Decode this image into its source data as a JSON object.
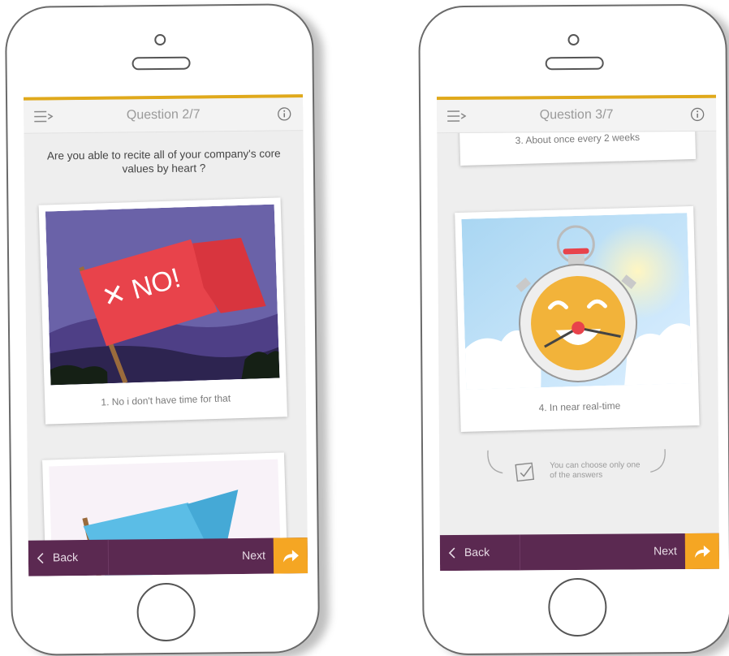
{
  "left_phone": {
    "title": "Question 2/7",
    "question": "Are you able to recite all of your company's core values by heart ?",
    "cards": [
      {
        "flag_text": "NO!",
        "caption": "1. No i don't have time for that"
      }
    ],
    "back_label": "Back",
    "next_label": "Next"
  },
  "right_phone": {
    "title": "Question 3/7",
    "cards": [
      {
        "caption": "3. About once every 2 weeks"
      },
      {
        "caption": "4. In near real-time"
      }
    ],
    "hint": "You can choose only one of the answers",
    "back_label": "Back",
    "next_label": "Next"
  },
  "icons": [
    "menu-icon",
    "info-icon",
    "chevron-left-icon",
    "share-arrow-icon",
    "checkbox-icon",
    "camera-icon",
    "speaker-icon",
    "home-button"
  ],
  "colors": {
    "accent": "#e0a91b",
    "bottom_bar": "#5b2951",
    "next_button": "#f5a623"
  }
}
